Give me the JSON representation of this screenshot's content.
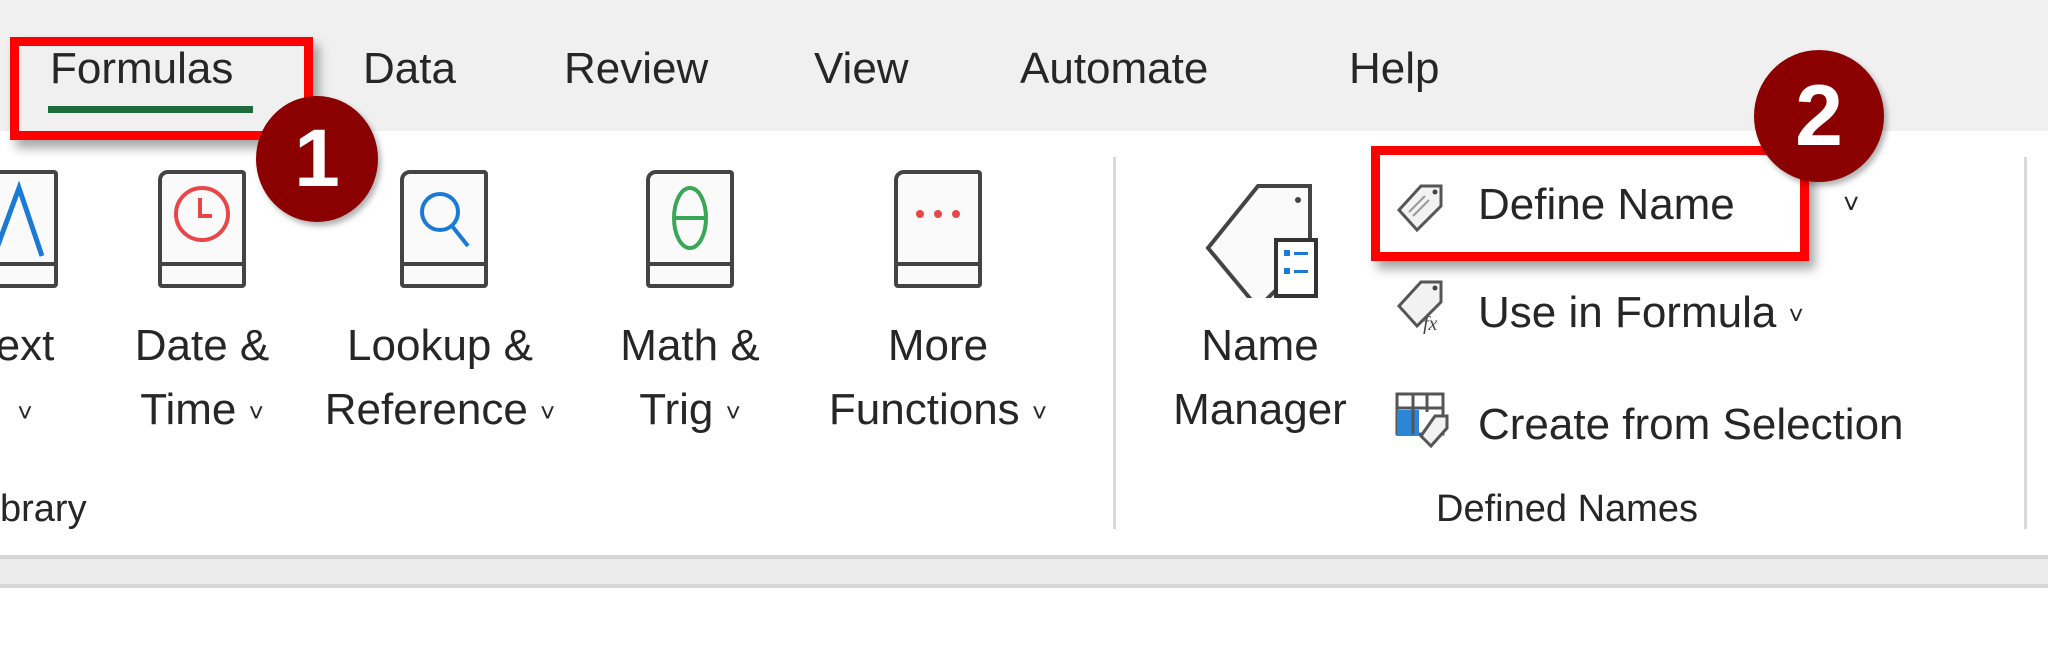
{
  "tabs": [
    {
      "label": "Formulas",
      "active": true
    },
    {
      "label": "Data"
    },
    {
      "label": "Review"
    },
    {
      "label": "View"
    },
    {
      "label": "Automate"
    },
    {
      "label": "Help"
    }
  ],
  "function_library": {
    "group_label": "brary",
    "buttons": [
      {
        "line1": "ext",
        "line2": "˅"
      },
      {
        "line1": "Date &",
        "line2": "Time"
      },
      {
        "line1": "Lookup &",
        "line2": "Reference"
      },
      {
        "line1": "Math &",
        "line2": "Trig"
      },
      {
        "line1": "More",
        "line2": "Functions"
      }
    ]
  },
  "defined_names": {
    "group_label": "Defined Names",
    "name_manager": {
      "line1": "Name",
      "line2": "Manager"
    },
    "define_name": "Define Name",
    "use_in_formula": "Use in Formula",
    "create_from_selection": "Create from Selection"
  },
  "annotations": {
    "step1": "1",
    "step2": "2"
  },
  "chevron": "˅",
  "colors": {
    "highlight": "#ff0000",
    "badge": "#8b0000",
    "tab_underline": "#1e6b3a"
  }
}
